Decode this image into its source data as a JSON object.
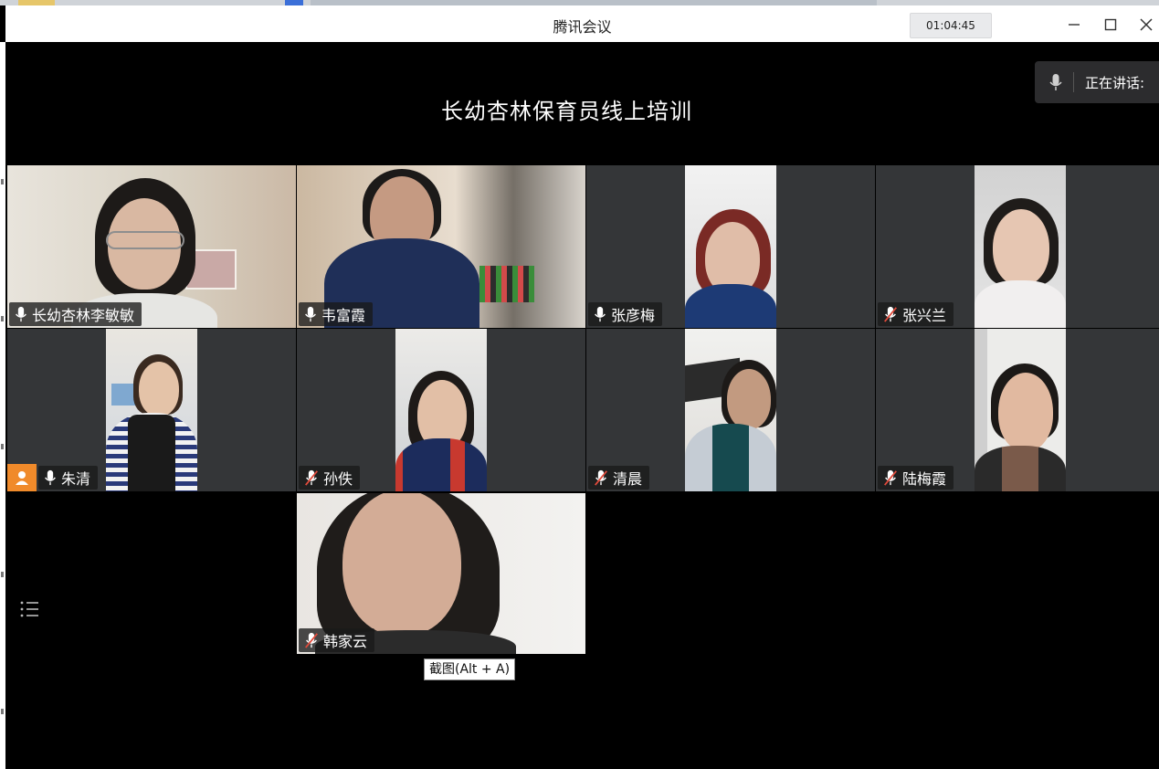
{
  "window": {
    "title": "腾讯会议",
    "timer": "01:04:45",
    "minimize_glyph": "—",
    "maximize_glyph": "☐",
    "close_glyph": "✕"
  },
  "meeting": {
    "title": "长幼杏林保育员线上培训",
    "speaking_label": "正在讲话: "
  },
  "participants": [
    {
      "name": "长幼杏林李敏敏",
      "mic": "mic-icon"
    },
    {
      "name": "韦富霞",
      "mic": "mic-icon"
    },
    {
      "name": "张彦梅",
      "mic": "mic-icon"
    },
    {
      "name": "张兴兰",
      "mic": "mic-muted-icon"
    },
    {
      "name": "朱清",
      "mic": "mic-icon",
      "host": true
    },
    {
      "name": "孙佚",
      "mic": "mic-muted-icon"
    },
    {
      "name": "清晨",
      "mic": "mic-muted-icon"
    },
    {
      "name": "陆梅霞",
      "mic": "mic-muted-icon"
    },
    {
      "name": "韩家云",
      "mic": "mic-muted-icon"
    }
  ],
  "tooltip": {
    "screenshot": "截图(Alt + A)"
  },
  "colors": {
    "background": "#000000",
    "tile": "#343638",
    "active_border": "#35b36a",
    "host_badge": "#f08a2a",
    "muted_red": "#e04a3b"
  }
}
